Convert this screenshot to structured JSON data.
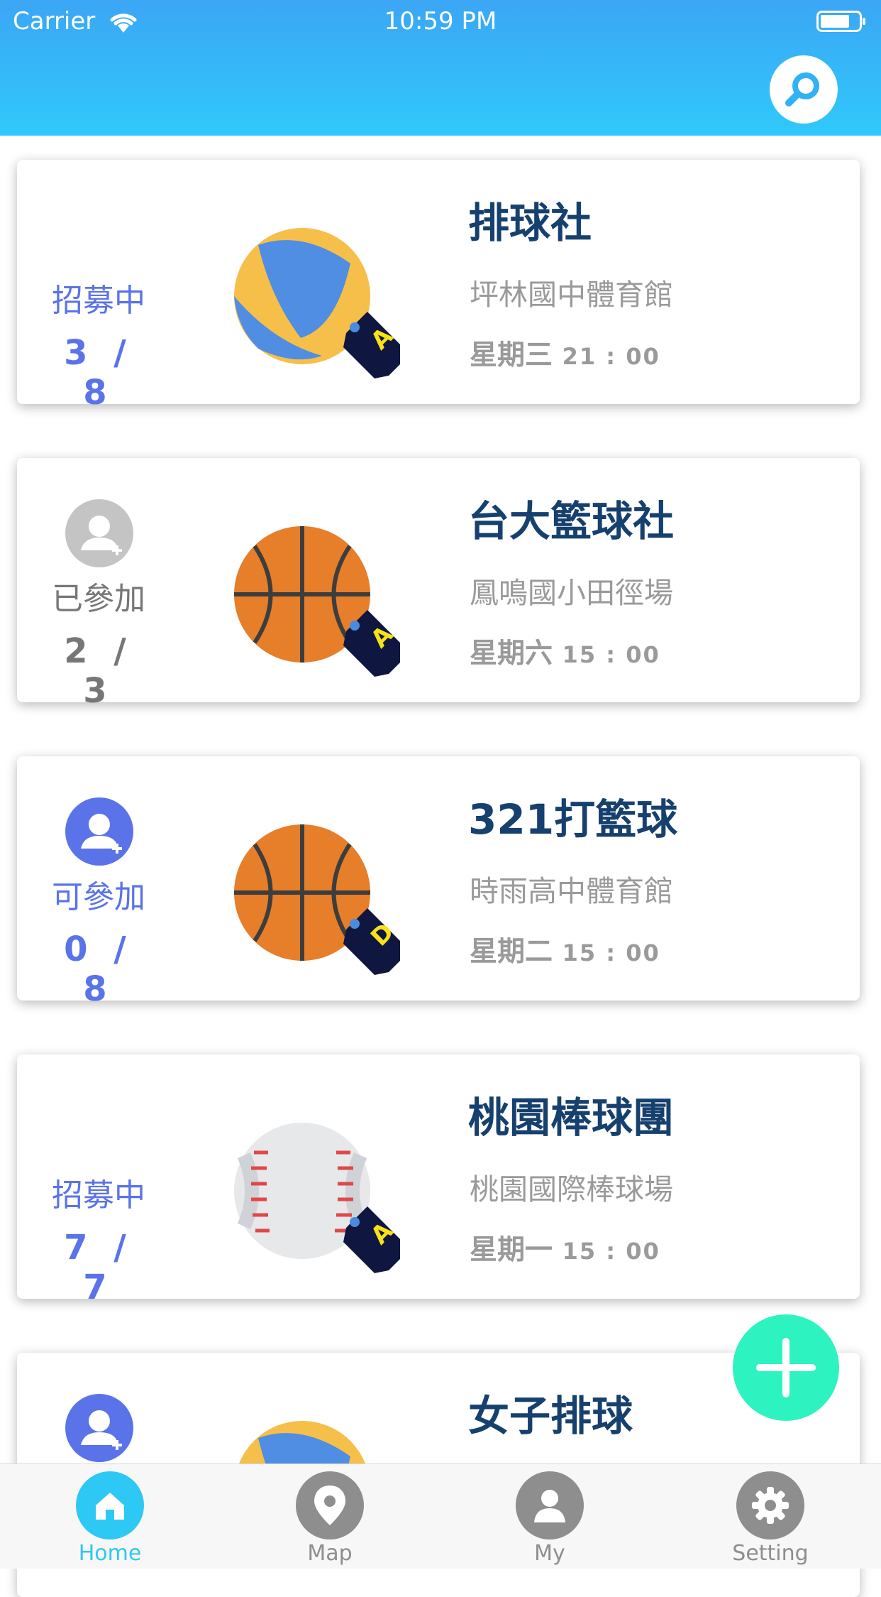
{
  "status_bar": {
    "carrier": "Carrier",
    "time": "10:59 PM"
  },
  "colors": {
    "accent": "#5b73e8",
    "header": "#3ba6f5",
    "fab": "#2df3c0",
    "title": "#16406e",
    "tab_active": "#2ec8f5"
  },
  "cards": [
    {
      "title": "排球社",
      "venue": "坪林國中體育館",
      "day": "星期三",
      "time": "21 : 00",
      "status": "招募中",
      "count": "3 / 8",
      "sport": "volleyball",
      "level": "A"
    },
    {
      "title": "台大籃球社",
      "venue": "鳳鳴國小田徑場",
      "day": "星期六",
      "time": "15 : 00",
      "status": "已參加",
      "count": "2 / 3",
      "sport": "basketball",
      "level": "A"
    },
    {
      "title": "321打籃球",
      "venue": "時雨高中體育館",
      "day": "星期二",
      "time": "15 : 00",
      "status": "可參加",
      "count": "0 / 8",
      "sport": "basketball",
      "level": "D"
    },
    {
      "title": "桃園棒球團",
      "venue": "桃園國際棒球場",
      "day": "星期一",
      "time": "15 : 00",
      "status": "招募中",
      "count": "7 / 7",
      "sport": "baseball",
      "level": "A"
    },
    {
      "title": "女子排球",
      "sport": "volleyball"
    }
  ],
  "tabs": [
    {
      "label": "Home",
      "icon": "home-icon",
      "active": true
    },
    {
      "label": "Map",
      "icon": "map-pin-icon",
      "active": false
    },
    {
      "label": "My",
      "icon": "user-icon",
      "active": false
    },
    {
      "label": "Setting",
      "icon": "gear-icon",
      "active": false
    }
  ]
}
